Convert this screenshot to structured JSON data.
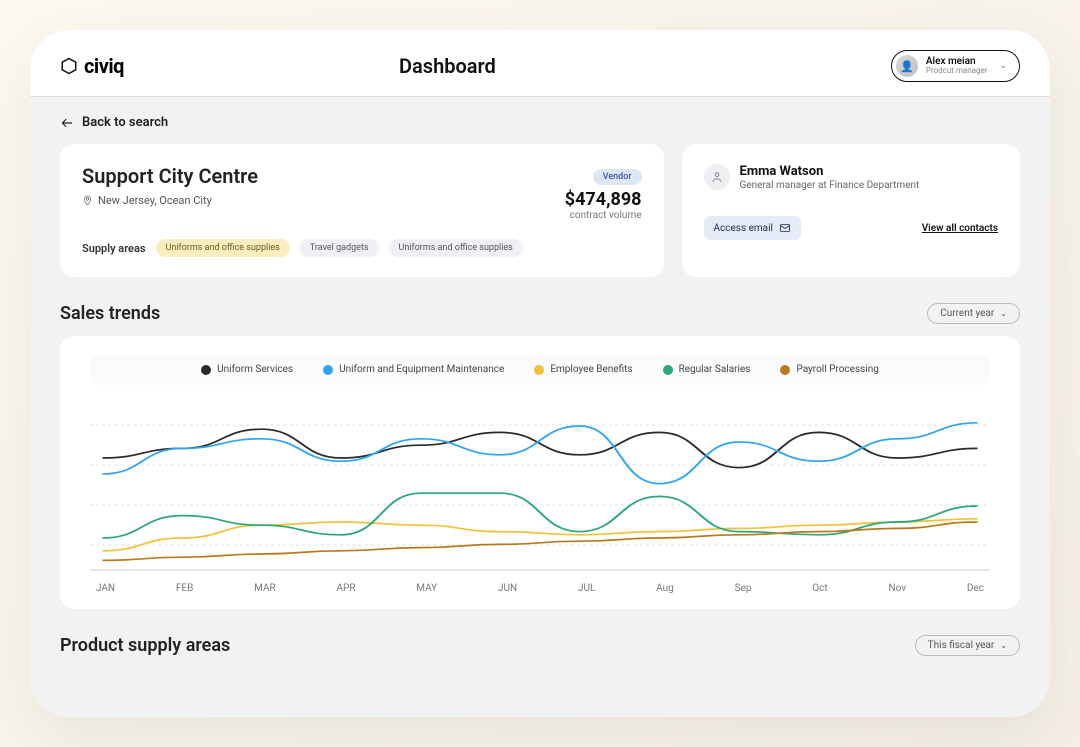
{
  "brand": "civiq",
  "page_title": "Dashboard",
  "user": {
    "name": "Alex meian",
    "role": "Prodcut manager"
  },
  "back_label": "Back to search",
  "vendor": {
    "name": "Support City Centre",
    "location": "New Jersey, Ocean City",
    "badge": "Vendor",
    "amount": "$474,898",
    "amount_sub": "contract volume",
    "supply_label": "Supply areas",
    "tags": [
      "Uniforms and office supplies",
      "Travel gadgets",
      "Uniforms and office supplies"
    ]
  },
  "contact": {
    "name": "Emma Watson",
    "role": "General manager at Finance Department",
    "email_btn": "Access email",
    "view_all": "View all contacts"
  },
  "trends": {
    "title": "Sales trends",
    "select": "Current year",
    "legend": [
      {
        "label": "Uniform Services",
        "color": "#2a2a2a"
      },
      {
        "label": "Uniform and Equipment Maintenance",
        "color": "#2ea6f0"
      },
      {
        "label": "Employee Benefits",
        "color": "#f0c23a"
      },
      {
        "label": "Regular Salaries",
        "color": "#2aa87a"
      },
      {
        "label": "Payroll Processing",
        "color": "#b97a1e"
      }
    ],
    "months": [
      "JAN",
      "FEB",
      "MAR",
      "APR",
      "MAY",
      "JUN",
      "JUL",
      "Aug",
      "Sep",
      "Oct",
      "Nov",
      "Dec"
    ]
  },
  "product": {
    "title": "Product supply areas",
    "select": "This fiscal year"
  },
  "chart_data": {
    "type": "line",
    "categories": [
      "JAN",
      "FEB",
      "MAR",
      "APR",
      "MAY",
      "JUN",
      "JUL",
      "Aug",
      "Sep",
      "Oct",
      "Nov",
      "Dec"
    ],
    "ylim": [
      0,
      100
    ],
    "series": [
      {
        "name": "Uniform Services",
        "color": "#2a2a2a",
        "values": [
          70,
          76,
          88,
          70,
          78,
          86,
          72,
          86,
          64,
          86,
          70,
          76
        ]
      },
      {
        "name": "Uniform and Equipment Maintenance",
        "color": "#2ea6f0",
        "values": [
          60,
          76,
          82,
          68,
          82,
          72,
          90,
          54,
          80,
          68,
          82,
          92
        ]
      },
      {
        "name": "Employee Benefits",
        "color": "#f0c23a",
        "values": [
          12,
          20,
          28,
          30,
          28,
          24,
          22,
          24,
          26,
          28,
          30,
          32
        ]
      },
      {
        "name": "Regular Salaries",
        "color": "#2aa87a",
        "values": [
          20,
          34,
          28,
          22,
          48,
          48,
          24,
          46,
          24,
          22,
          30,
          40
        ]
      },
      {
        "name": "Payroll Processing",
        "color": "#b97a1e",
        "values": [
          6,
          8,
          10,
          12,
          14,
          16,
          18,
          20,
          22,
          24,
          26,
          30
        ]
      }
    ]
  }
}
